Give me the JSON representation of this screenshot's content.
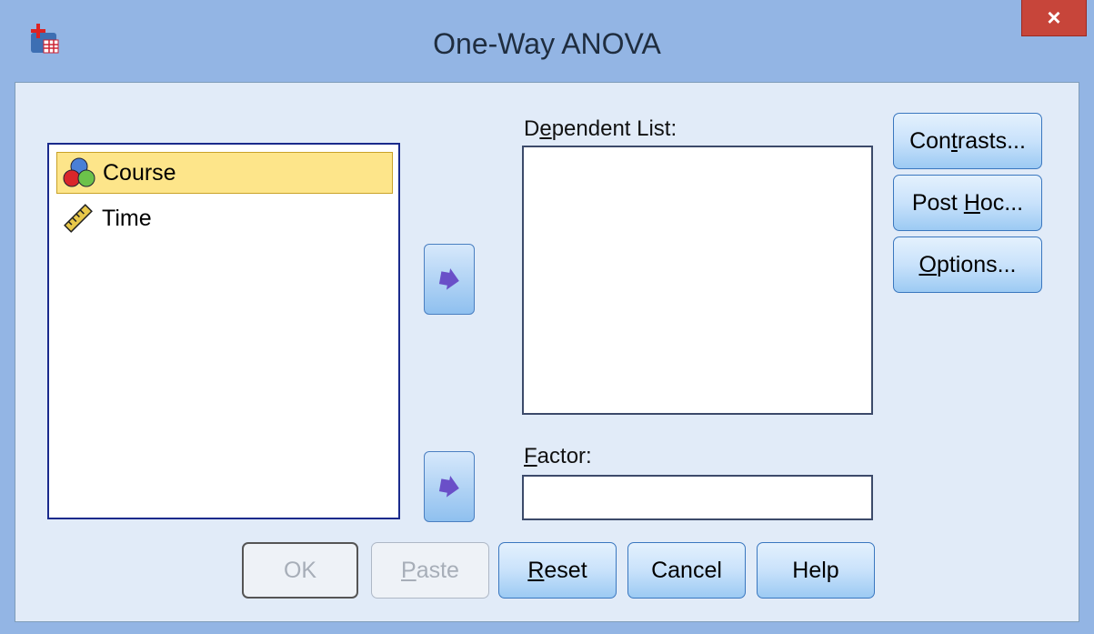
{
  "window": {
    "title": "One-Way ANOVA",
    "close_glyph": "×"
  },
  "variables": [
    {
      "name": "Course",
      "icon": "nominal-variable-icon",
      "selected": true
    },
    {
      "name": "Time",
      "icon": "scale-variable-icon",
      "selected": false
    }
  ],
  "dependent_list": {
    "label_pre": "D",
    "label_key": "e",
    "label_post": "pendent List:"
  },
  "factor": {
    "label_key": "F",
    "label_post": "actor:",
    "value": ""
  },
  "side_buttons": {
    "contrasts": {
      "pre": "Con",
      "key": "t",
      "post": "rasts..."
    },
    "post_hoc": {
      "pre": "Post ",
      "key": "H",
      "post": "oc..."
    },
    "options": {
      "pre": "",
      "key": "O",
      "post": "ptions..."
    }
  },
  "bottom_buttons": {
    "ok": "OK",
    "paste": {
      "key": "P",
      "post": "aste"
    },
    "reset": {
      "key": "R",
      "post": "eset"
    },
    "cancel": "Cancel",
    "help": "Help"
  },
  "colors": {
    "titlebar": "#93b5e4",
    "client": "#e1ebf8",
    "close": "#c7453a",
    "selection": "#fde58a",
    "arrow": "#6a4fc8"
  }
}
